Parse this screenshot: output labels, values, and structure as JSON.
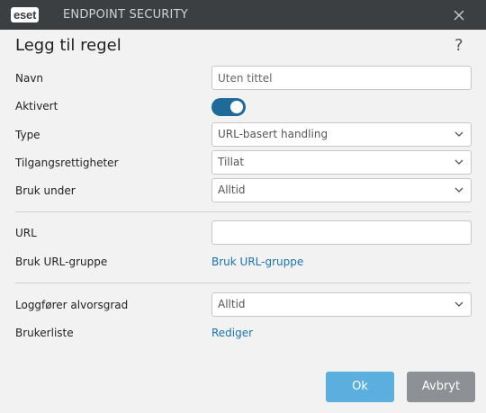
{
  "titlebar": {
    "logo_text": "eset",
    "app_title": "ENDPOINT SECURITY"
  },
  "dialog": {
    "title": "Legg til regel",
    "help": "?"
  },
  "form": {
    "name": {
      "label": "Navn",
      "placeholder": "Uten tittel",
      "value": ""
    },
    "enabled": {
      "label": "Aktivert",
      "on": true
    },
    "type": {
      "label": "Type",
      "value": "URL-basert handling"
    },
    "access": {
      "label": "Tilgangsrettigheter",
      "value": "Tillat"
    },
    "apply_during": {
      "label": "Bruk under",
      "value": "Alltid"
    },
    "url": {
      "label": "URL",
      "value": ""
    },
    "url_group": {
      "label": "Bruk URL-gruppe",
      "link": "Bruk URL-gruppe"
    },
    "log_severity": {
      "label": "Loggfører alvorsgrad",
      "value": "Alltid"
    },
    "user_list": {
      "label": "Brukerliste",
      "link": "Rediger"
    }
  },
  "buttons": {
    "ok": "Ok",
    "cancel": "Avbryt"
  },
  "colors": {
    "titlebar": "#3b3f42",
    "toggle_on": "#1e6b99",
    "ok_button": "#5aafdf",
    "cancel_button": "#8d9195",
    "link": "#1a73b0"
  }
}
